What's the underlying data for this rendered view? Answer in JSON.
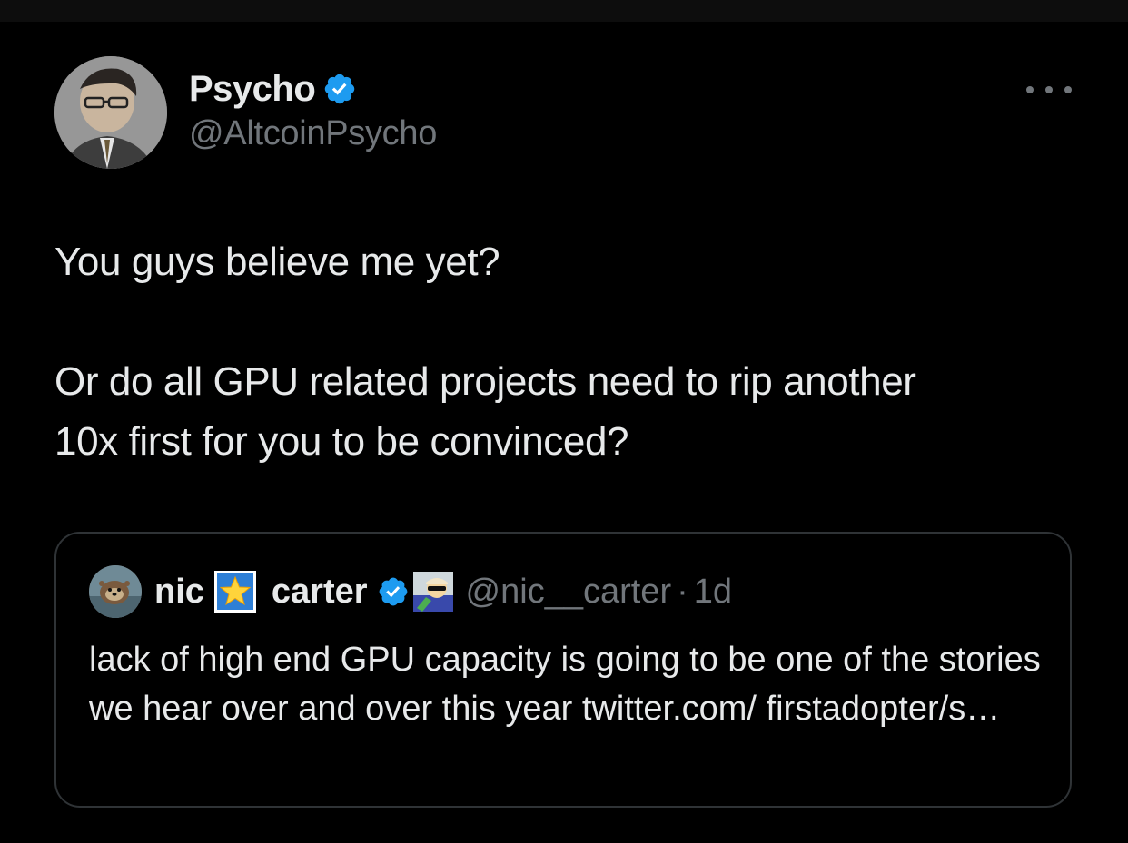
{
  "author": {
    "display_name": "Psycho",
    "handle": "@AltcoinPsycho",
    "verified": true,
    "avatar_icon": "person-avatar-icon"
  },
  "tweet": {
    "line1": "You guys believe me yet?",
    "line2": "Or do all GPU related projects need to rip another",
    "line3": "10x first for you to be convinced?"
  },
  "quote": {
    "name_first": "nic",
    "name_last": "carter",
    "handle": "@nic__carter",
    "separator": "·",
    "time": "1d",
    "verified": true,
    "text": "lack of high end GPU capacity is going to be one of the stories we hear over and over this year twitter.com/ firstadopter/s…"
  },
  "colors": {
    "background": "#000000",
    "text": "#e7e9ea",
    "muted": "#71767b",
    "verified_blue": "#1d9bf0",
    "border": "#2f3336"
  }
}
